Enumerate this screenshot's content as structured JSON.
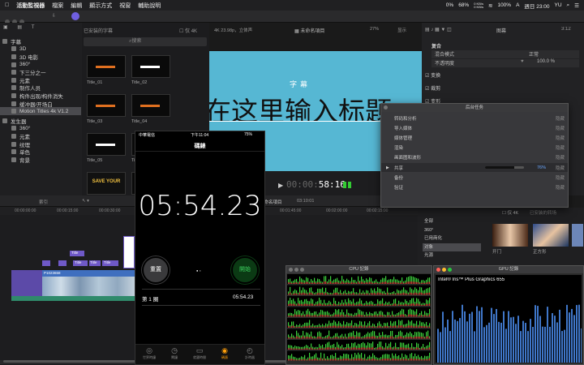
{
  "menubar": {
    "app": "活動監視器",
    "items": [
      "檔案",
      "編輯",
      "顯示方式",
      "視窗",
      "輔助說明"
    ],
    "battery_pct": "0%",
    "cpu_pct": "68%",
    "net_up": "0 KB/s",
    "net_down": "0 KB/s",
    "battery": "100%",
    "clock": "週日 23:00",
    "user": "YU"
  },
  "library": {
    "items": [
      {
        "label": "字幕",
        "indent": 0
      },
      {
        "label": "3D",
        "indent": 1
      },
      {
        "label": "3D 电影",
        "indent": 1
      },
      {
        "label": "360°",
        "indent": 1
      },
      {
        "label": "下三分之一",
        "indent": 1
      },
      {
        "label": "元素",
        "indent": 1
      },
      {
        "label": "制作人员",
        "indent": 1
      },
      {
        "label": "构件出现/构件消失",
        "indent": 1
      },
      {
        "label": "缓冲器/开场白",
        "indent": 1
      },
      {
        "label": "Motion Titles 4k V1.2",
        "indent": 1,
        "selected": true
      },
      {
        "label": "发生器",
        "indent": 0
      },
      {
        "label": "360°",
        "indent": 1
      },
      {
        "label": "元素",
        "indent": 1
      },
      {
        "label": "纹理",
        "indent": 1
      },
      {
        "label": "单色",
        "indent": 1
      },
      {
        "label": "背景",
        "indent": 1
      }
    ]
  },
  "browser": {
    "filter_label": "已安装的字幕",
    "only4k_label": "仅 4K",
    "search_placeholder": "搜索",
    "thumbs": [
      {
        "label": "Title_01",
        "text": ""
      },
      {
        "label": "Title_02",
        "text": ""
      },
      {
        "label": "Title_03",
        "text": ""
      },
      {
        "label": "Title_04",
        "text": ""
      },
      {
        "label": "Title_05",
        "text": ""
      },
      {
        "label": "Title_06",
        "text": ""
      },
      {
        "label": "",
        "text": "SAVE YOUR"
      },
      {
        "label": "",
        "text": ""
      }
    ]
  },
  "viewer": {
    "format": "4K 23.98p，立体声",
    "project": "未命名項目",
    "zoom": "27%",
    "view_label": "显示",
    "subtitle": "字幕",
    "main_text": "在这里输入标题",
    "timecode": "58:16"
  },
  "inspector": {
    "title": "图幕",
    "timecode": "3:12",
    "section": "复合",
    "blend_label": "混合模式",
    "blend_value": "正常",
    "opacity_label": "不透明度",
    "opacity_value": "100.0 %",
    "rows": [
      "变换",
      "裁剪",
      "变形"
    ]
  },
  "bgtasks": {
    "title": "后台任务",
    "rows": [
      {
        "label": "转码和分析",
        "action": "隐藏"
      },
      {
        "label": "导入媒体",
        "action": "隐藏"
      },
      {
        "label": "媒体管理",
        "action": "隐藏"
      },
      {
        "label": "渲染",
        "action": "隐藏"
      },
      {
        "label": "画面图和波形",
        "action": "隐藏"
      },
      {
        "label": "共享",
        "action": "隐藏",
        "progress": "76%"
      },
      {
        "label": "备份",
        "action": "隐藏"
      },
      {
        "label": "验证",
        "action": "隐藏"
      }
    ]
  },
  "timeline": {
    "index_label": "索引",
    "project": "未命名項目",
    "duration": "03:10:01",
    "ruler": [
      "00:00:00:00",
      "00:00:15:00",
      "00:00:30:00",
      "00:00:45:00"
    ],
    "ruler_right": [
      "00:01:45:00",
      "00:02:00:00",
      "00:02:15:00"
    ],
    "clip_names": [
      "P1023658",
      "Title",
      "Title",
      "Title",
      "Title",
      "Title",
      "Title"
    ]
  },
  "stopwatch": {
    "carrier": "中華電信",
    "time": "下午11:04",
    "battery": "75%",
    "title": "碼錶",
    "display": "05:54.23",
    "reset_label": "重置",
    "start_label": "開始",
    "lap_label": "第 1 圈",
    "lap_time": "05:54.23",
    "tabs": [
      "世界時鐘",
      "鬧鐘",
      "就寢時間",
      "碼錶",
      "計時器"
    ],
    "active_tab": 3
  },
  "effects": {
    "label": "仅 4K",
    "installed": "已安装的转场",
    "categories": [
      "全部",
      "360°",
      "已用商化",
      "对象",
      "光源"
    ],
    "selected_category": 3,
    "items": [
      {
        "label": "开门"
      },
      {
        "label": "正方形"
      }
    ]
  },
  "cpu": {
    "title": "CPU 記錄"
  },
  "gpu": {
    "title": "GPU 記錄",
    "device": "Intel® Iris™ Plus Graphics 655"
  },
  "colors": {
    "accent": "#2f7bf5",
    "viewer_bg": "#56b7d3",
    "purple": "#6f59c8",
    "blue_clip": "#3f6fbf"
  }
}
